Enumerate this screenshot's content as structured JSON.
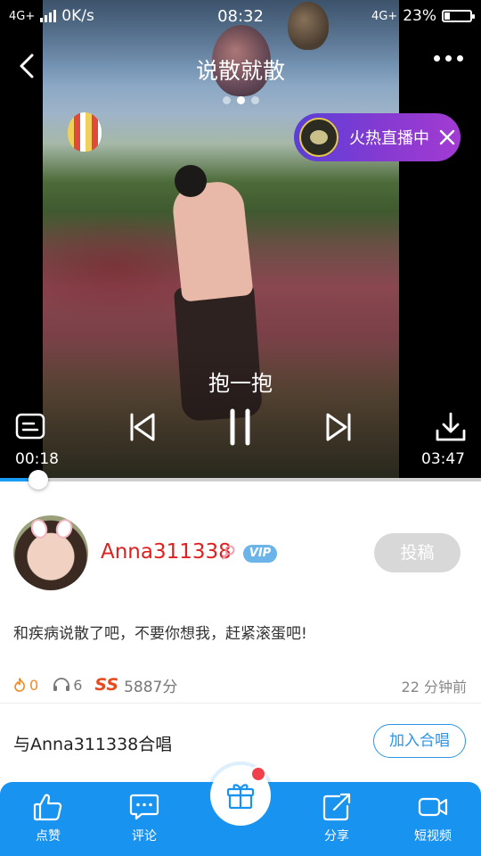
{
  "status_bar": {
    "network_left": "4G+",
    "speed": "0K/s",
    "time": "08:32",
    "network_right": "4G+",
    "battery": "23%",
    "battery_level": 0.23
  },
  "header": {
    "title": "说散就散",
    "page_count": 3,
    "active_page": 2
  },
  "live": {
    "label": "火热直播中"
  },
  "player": {
    "lyric": "抱一抱",
    "current_time": "00:18",
    "total_time": "03:47",
    "progress": 0.079
  },
  "user": {
    "name": "Anna311338",
    "vip_label": "VIP",
    "submit_label": "投稿",
    "description": "和疾病说散了吧，不要你想我，赶紧滚蛋吧!"
  },
  "stats": {
    "flames": "0",
    "listens": "6",
    "score_badge": "SS",
    "score": "5887分",
    "time_ago": "22 分钟前"
  },
  "chorus": {
    "text": "与Anna311338合唱",
    "button": "加入合唱"
  },
  "bottom_tabs": {
    "like": "点赞",
    "comment": "评论",
    "share": "分享",
    "short_video": "短视频"
  },
  "colors": {
    "accent": "#1993f0",
    "username": "#e02020",
    "live_pill": "#7a3ad3"
  }
}
